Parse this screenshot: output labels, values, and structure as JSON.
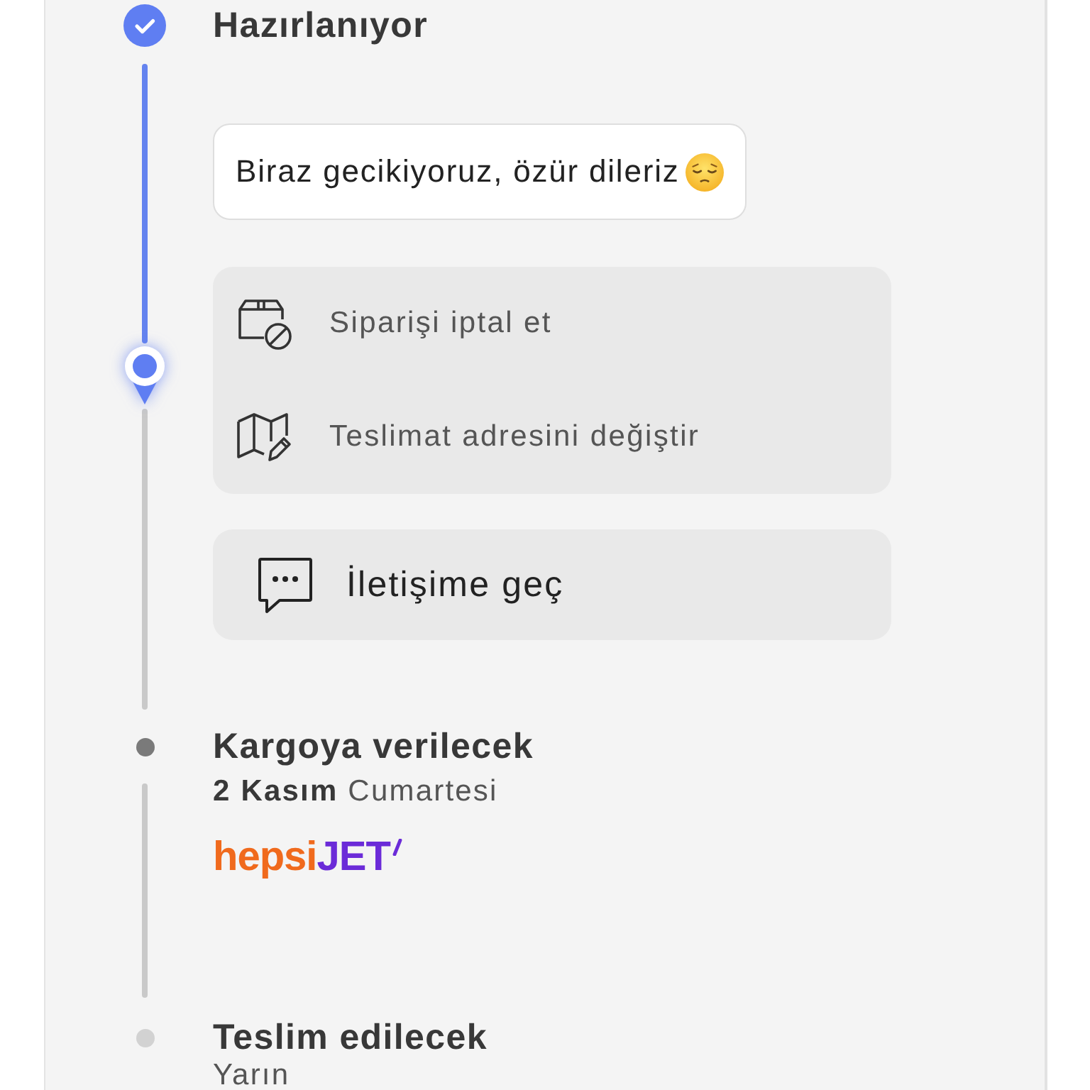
{
  "steps": [
    {
      "title": "Hazırlanıyor",
      "kind": "done",
      "message": "Biraz gecikiyoruz, özür dileriz",
      "actions": [
        {
          "kind": "cancel",
          "label": "Siparişi iptal et"
        },
        {
          "kind": "address",
          "label": "Teslimat adresini değiştir"
        }
      ],
      "contact": {
        "label": "İletişime geç"
      }
    },
    {
      "title": "Kargoya verilecek",
      "kind": "next",
      "date": "**2 Kasım** Cumartesi",
      "carrier": {
        "parts": [
          {
            "text": "hepsi",
            "color": "#f06a1d"
          },
          {
            "text": "JET",
            "color": "#6b2bd8"
          }
        ]
      }
    },
    {
      "title": "Teslim edilecek",
      "kind": "later",
      "date": "Yarın"
    }
  ]
}
